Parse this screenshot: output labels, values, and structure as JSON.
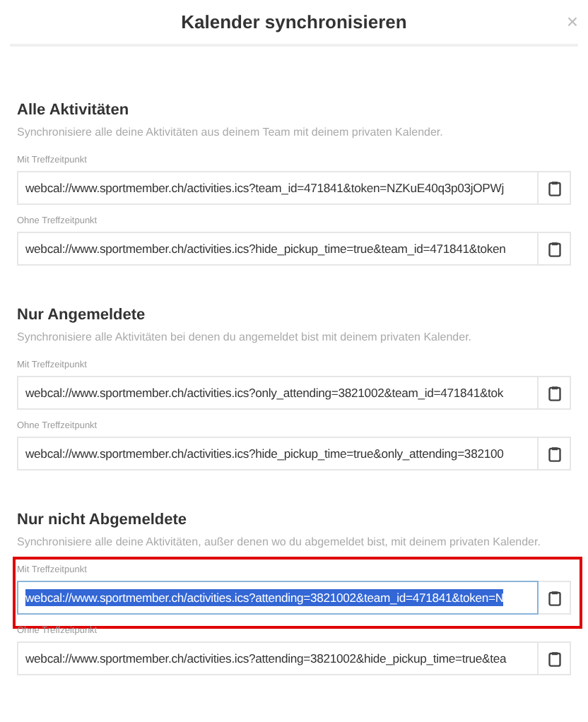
{
  "dialog": {
    "title": "Kalender synchronisieren",
    "close": "×"
  },
  "sections": [
    {
      "title": "Alle Aktivitäten",
      "description": "Synchronisiere alle deine Aktivitäten aus deinem Team mit deinem privaten Kalender.",
      "links": [
        {
          "label": "Mit Treffzeitpunkt",
          "value": "webcal://www.sportmember.ch/activities.ics?team_id=471841&token=NZKuE40q3p03jOPWj",
          "selected": false,
          "highlighted": false
        },
        {
          "label": "Ohne Treffzeitpunkt",
          "value": "webcal://www.sportmember.ch/activities.ics?hide_pickup_time=true&team_id=471841&token",
          "selected": false,
          "highlighted": false
        }
      ]
    },
    {
      "title": "Nur Angemeldete",
      "description": "Synchronisiere alle Aktivitäten bei denen du angemeldet bist mit deinem privaten Kalender.",
      "links": [
        {
          "label": "Mit Treffzeitpunkt",
          "value": "webcal://www.sportmember.ch/activities.ics?only_attending=3821002&team_id=471841&tok",
          "selected": false,
          "highlighted": false
        },
        {
          "label": "Ohne Treffzeitpunkt",
          "value": "webcal://www.sportmember.ch/activities.ics?hide_pickup_time=true&only_attending=382100",
          "selected": false,
          "highlighted": false
        }
      ]
    },
    {
      "title": "Nur nicht Abgemeldete",
      "description": "Synchronisiere alle deine Aktivitäten, außer denen wo du abgemeldet bist, mit deinem privaten Kalender.",
      "links": [
        {
          "label": "Mit Treffzeitpunkt",
          "value": "webcal://www.sportmember.ch/activities.ics?attending=3821002&team_id=471841&token=N",
          "selected": true,
          "highlighted": true
        },
        {
          "label": "Ohne Treffzeitpunkt",
          "value": "webcal://www.sportmember.ch/activities.ics?attending=3821002&hide_pickup_time=true&tea",
          "selected": false,
          "highlighted": false
        }
      ]
    }
  ]
}
